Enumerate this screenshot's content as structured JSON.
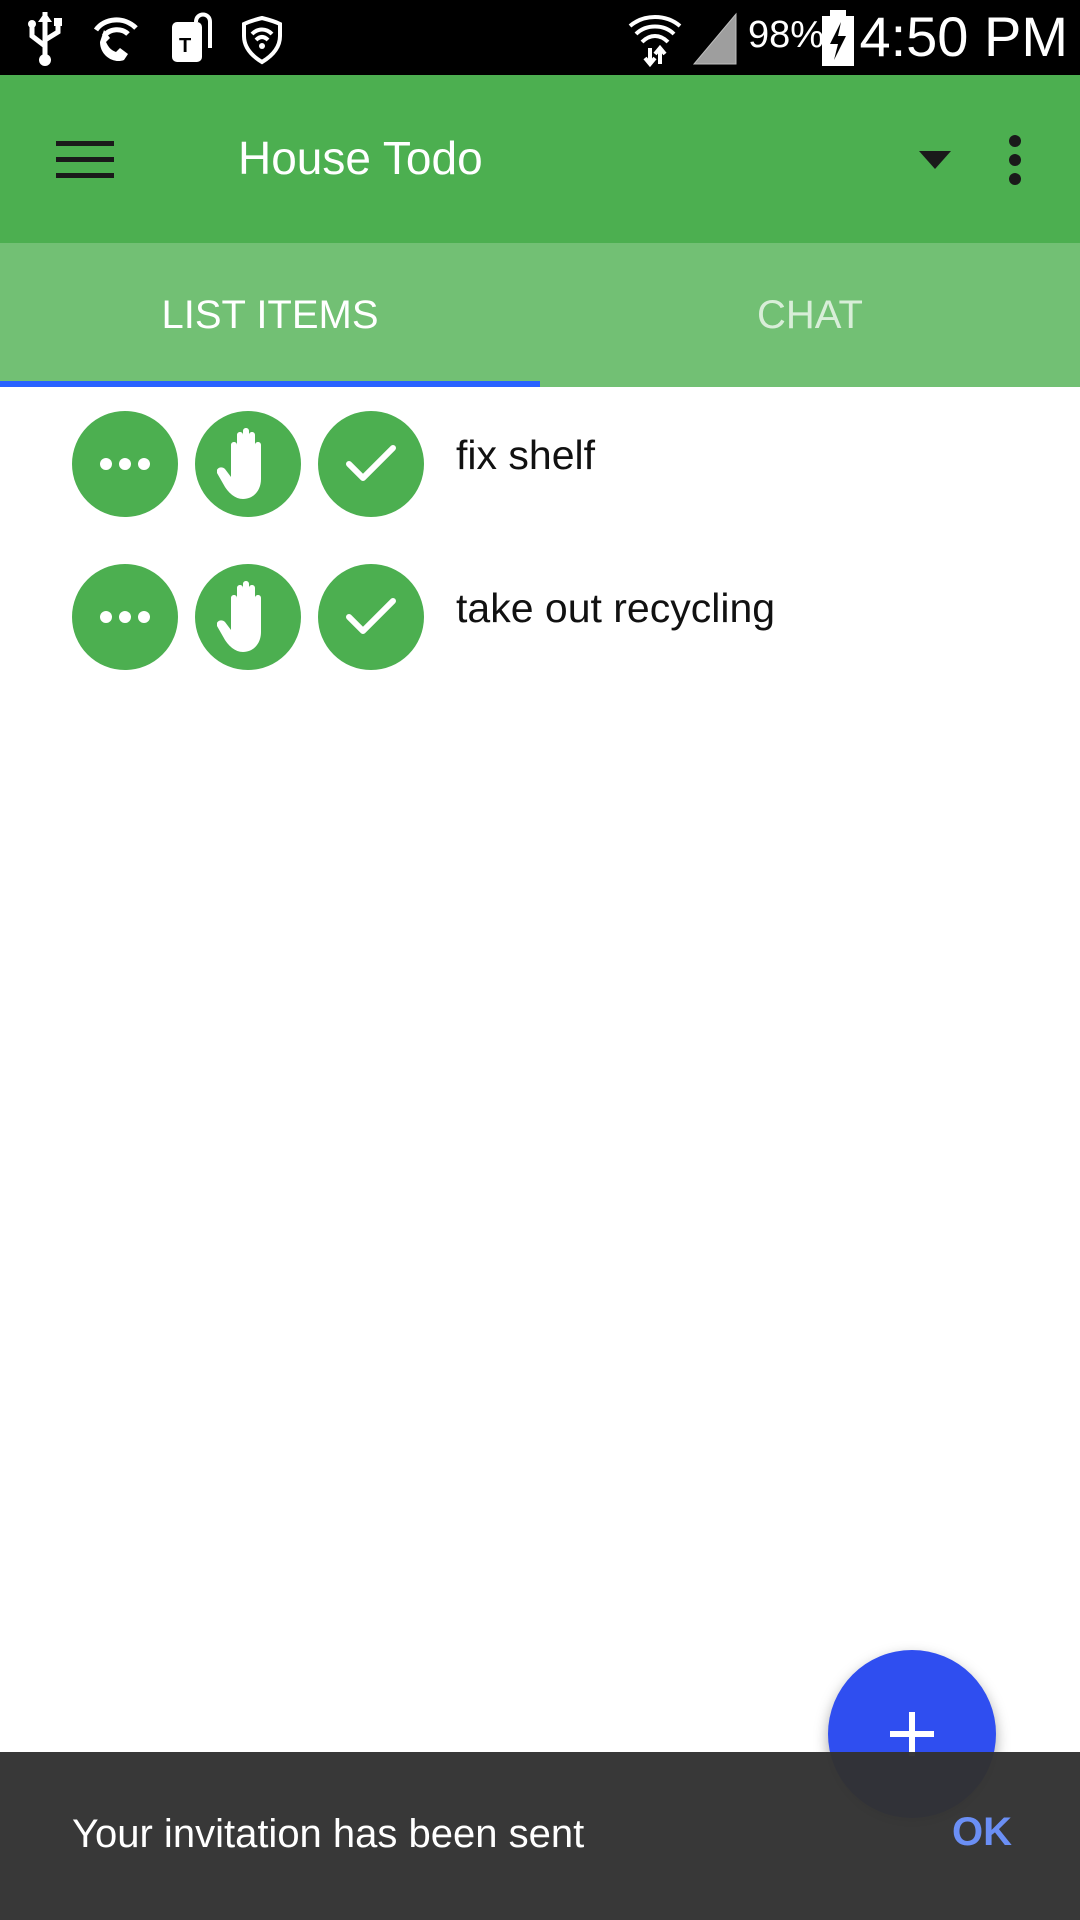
{
  "status_bar": {
    "battery_percent": "98%",
    "time": "4:50 PM",
    "icons": [
      "usb-icon",
      "wifi-calling-icon",
      "tmobile-tag-icon",
      "shield-wifi-icon",
      "wifi-signal-icon",
      "cell-signal-icon",
      "battery-charging-icon"
    ]
  },
  "app_bar": {
    "title": "House Todo",
    "menu_icon": "hamburger-menu-icon",
    "dropdown_icon": "dropdown-arrow-icon",
    "overflow_icon": "overflow-menu-icon"
  },
  "tabs": [
    {
      "label": "LIST ITEMS",
      "selected": true
    },
    {
      "label": "CHAT",
      "selected": false
    }
  ],
  "list": {
    "items": [
      {
        "label": "fix shelf",
        "actions": [
          "more-icon",
          "hand-icon",
          "check-icon"
        ]
      },
      {
        "label": "take out recycling",
        "actions": [
          "more-icon",
          "hand-icon",
          "check-icon"
        ]
      }
    ]
  },
  "fab": {
    "icon": "plus-icon"
  },
  "snackbar": {
    "message": "Your invitation has been sent",
    "action": "OK"
  },
  "colors": {
    "status_bar": "#000000",
    "app_bar": "#4caf50",
    "tab_bar": "#72c074",
    "tab_indicator": "#2962ff",
    "action_button": "#4caf50",
    "fab": "#2f4ef0",
    "snackbar": "#323232",
    "snackbar_action": "#6b8ff5"
  }
}
